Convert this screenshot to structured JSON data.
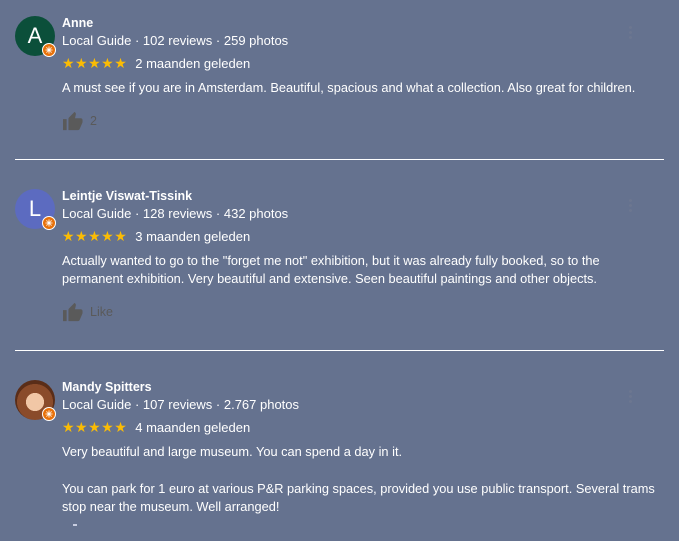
{
  "reviews": [
    {
      "initial": "A",
      "avatar_color": "#0b4f3a",
      "name": "Anne",
      "meta": "Local Guide · 102 reviews · 259 photos",
      "stars": "★★★★★",
      "date": "2 maanden geleden",
      "text": "A must see if you are in Amsterdam. Beautiful, spacious and what a collection. Also great for children.",
      "like_label": "2"
    },
    {
      "initial": "L",
      "avatar_color": "#5c6bc0",
      "name": "Leintje Viswat-Tissink",
      "meta": "Local Guide · 128 reviews · 432 photos",
      "stars": "★★★★★",
      "date": "3 maanden geleden",
      "text": "Actually wanted to go to the \"forget me not\" exhibition, but it was already fully booked, so to the permanent exhibition. Very beautiful and extensive. Seen beautiful paintings and other objects.",
      "like_label": "Like"
    },
    {
      "initial": "",
      "name": "Mandy Spitters",
      "meta": "Local Guide · 107 reviews · 2.767 photos",
      "stars": "★★★★★",
      "date": "4 maanden geleden",
      "text_p1": "Very beautiful and large museum. You can spend a day in it.",
      "text_p2": "You can park for 1 euro at various P&R parking spaces, provided you use public transport. Several trams stop near the museum. Well arranged!"
    }
  ],
  "icons": {
    "guide_badge": "local-guide-badge-icon",
    "like": "thumb-up-icon",
    "more": "more-vert-icon"
  },
  "colors": {
    "background": "#65728f",
    "star": "#fbbc04",
    "badge": "#e8710a"
  }
}
